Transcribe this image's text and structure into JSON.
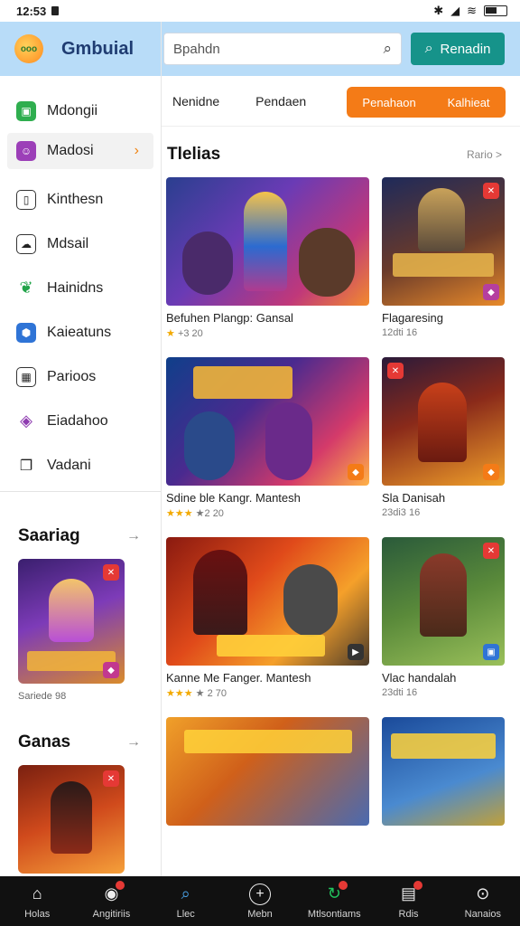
{
  "status": {
    "time": "12:53",
    "icons": [
      "bluetooth-icon",
      "signal-icon",
      "wifi-icon",
      "battery-icon"
    ]
  },
  "colors": {
    "accent": "#f47b17",
    "header": "#b8dcf8",
    "button": "#16938a",
    "nav": "#111111"
  },
  "drawer": {
    "title": "Gmbuial",
    "items": [
      {
        "label": "Mdongii",
        "icon": "controller-icon"
      },
      {
        "label": "Madosi",
        "icon": "chat-icon"
      },
      {
        "label": "Kinthesn",
        "icon": "book-icon"
      },
      {
        "label": "Mdsail",
        "icon": "message-icon"
      },
      {
        "label": "Hainidns",
        "icon": "leaf-icon"
      },
      {
        "label": "Kaieatuns",
        "icon": "shield-icon"
      },
      {
        "label": "Parioos",
        "icon": "grid-icon"
      },
      {
        "label": "Eiadahoo",
        "icon": "diamond-icon"
      },
      {
        "label": "Vadani",
        "icon": "cards-icon"
      }
    ],
    "sections": [
      {
        "title": "Saariag",
        "caption": "Sariede 98"
      },
      {
        "title": "Ganas",
        "caption": ""
      }
    ]
  },
  "topbar": {
    "search_placeholder": "Bpahdn",
    "search_button": "Renadin"
  },
  "tabs": {
    "items": [
      "Nenidne",
      "Pendaen"
    ],
    "group": [
      "Penahaon",
      "Kalhieat"
    ]
  },
  "content": {
    "title": "Tlelias",
    "see_all": "Rario >",
    "cards": [
      {
        "title": "Befuhen Plangp: Gansal",
        "stars": "★",
        "meta": "+3 20"
      },
      {
        "title": "Flagaresing",
        "stars": "",
        "meta": "12dti 16"
      },
      {
        "title": "Sdine ble Kangr. Mantesh",
        "stars": "★★★",
        "meta": "★2 20"
      },
      {
        "title": "Sla Danisah",
        "stars": "",
        "meta": "23di3 16"
      },
      {
        "title": "Kanne Me Fanger. Mantesh",
        "stars": "★★★",
        "meta": "★ 2 70"
      },
      {
        "title": "Vlac handalah",
        "stars": "",
        "meta": "23dti 16"
      }
    ]
  },
  "bottom_nav": [
    {
      "label": "Holas",
      "icon": "home-icon"
    },
    {
      "label": "Angitiriis",
      "icon": "gamepad-icon"
    },
    {
      "label": "Llec",
      "icon": "search-icon"
    },
    {
      "label": "Mebn",
      "icon": "plus-icon"
    },
    {
      "label": "Mtlsontiams",
      "icon": "refresh-icon"
    },
    {
      "label": "Rdis",
      "icon": "gift-icon"
    },
    {
      "label": "Nanaios",
      "icon": "magnify-icon"
    }
  ]
}
